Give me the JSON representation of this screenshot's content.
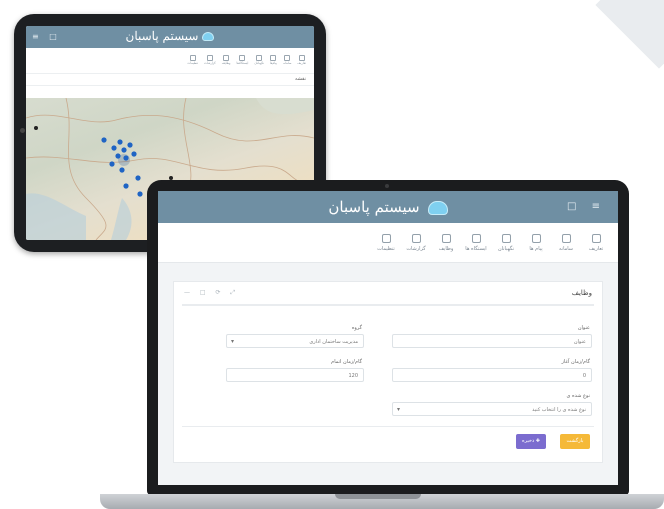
{
  "tablet": {
    "title": "سیستم پاسبان",
    "header_icons": "□ ≡",
    "toolbar": [
      "تعاریف",
      "سامانه",
      "پیام‌ها",
      "نگهبانان",
      "ایستگاه‌ها",
      "وظایف",
      "گزارشات",
      "تنظیمات"
    ],
    "bar_text": "نقشه"
  },
  "laptop": {
    "title": "سیستم پاسبان",
    "header_icons": "□ ≡",
    "toolbar": [
      "تعاریف",
      "سامانه",
      "پیام ها",
      "نگهبانان",
      "ایستگاه ها",
      "وظایف",
      "گزارشات",
      "تنظیمات"
    ],
    "card": {
      "title": "وظایف",
      "controls": "— □ ⟳ ⤢",
      "fields": {
        "name_label": "عنوان",
        "name_value": "عنوان",
        "group_label": "گروه",
        "group_value": "مدیریت ساختمان اداری",
        "start_label": "گام/زمان آغاز",
        "start_value": "0",
        "end_label": "گام/زمان اتمام",
        "end_value": "120",
        "type_label": "نوع شده ی",
        "type_value": "نوع شده ی را انتخاب کنید"
      },
      "cancel_label": "بازگشت",
      "save_label": "✚ ذخیره"
    }
  }
}
